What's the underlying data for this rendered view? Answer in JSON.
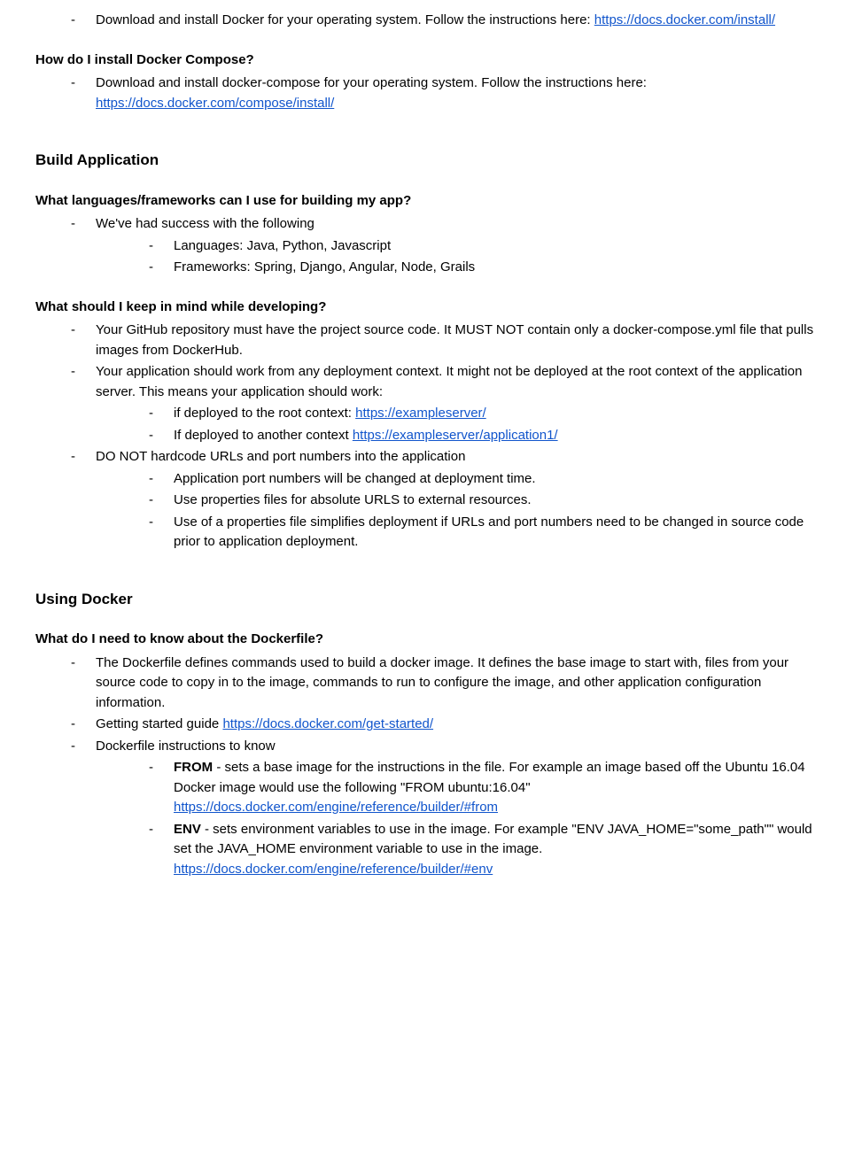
{
  "docker_install": {
    "item": "Download and install Docker for your operating system. Follow the instructions here: ",
    "link": "https://docs.docker.com/install/"
  },
  "compose": {
    "title": "How do I install Docker Compose?",
    "item_pre": "Download and install docker-compose for your operating system. Follow the instructions here: ",
    "link": "https://docs.docker.com/compose/install/"
  },
  "build_app": {
    "title": "Build Application"
  },
  "languages": {
    "title": "What languages/frameworks can I use for building my app?",
    "intro": "We've had success with the following",
    "lang": "Languages: Java, Python, Javascript",
    "fw": "Frameworks: Spring, Django, Angular, Node, Grails"
  },
  "developing": {
    "title": "What should I keep in mind while developing?",
    "github": "Your GitHub repository must have the project source code. It MUST NOT contain only a docker-compose.yml file that pulls images from DockerHub.",
    "context_intro": "Your application should work from any deployment context. It might not be deployed at the root context of the application server. This means your application should work:",
    "root_pre": "if deployed to the root context: ",
    "root_link": "https://exampleserver/",
    "other_pre": "If deployed to another context ",
    "other_link": "https://exampleserver/application1/",
    "hardcode": "DO NOT hardcode URLs and port numbers into the application",
    "ports": "Application port numbers will be changed at deployment time.",
    "props": "Use properties files for absolute URLS to external resources.",
    "props_simplify": "Use of a properties file simplifies deployment if URLs and port numbers need to be changed in source code prior to application deployment."
  },
  "using_docker": {
    "title": "Using Docker"
  },
  "dockerfile": {
    "title": "What do I need to know about the Dockerfile?",
    "def": "The Dockerfile defines commands used to build a docker image. It defines the base image to start with, files from your source code to copy in to the image, commands to run to configure the image, and other application configuration information.",
    "started_pre": "Getting started guide ",
    "started_link": "https://docs.docker.com/get-started/",
    "instructions": "Dockerfile instructions to know",
    "from_label": "FROM",
    "from_text": " - sets a base image for the instructions in the file. For example an image based off the Ubuntu 16.04 Docker image would use the following \"FROM ubuntu:16.04\" ",
    "from_link": "https://docs.docker.com/engine/reference/builder/#from",
    "env_label": "ENV",
    "env_text": " - sets environment variables to use in the image. For example \"ENV JAVA_HOME=\"some_path\"\" would set the JAVA_HOME environment variable to use in the image. ",
    "env_link": "https://docs.docker.com/engine/reference/builder/#env"
  }
}
